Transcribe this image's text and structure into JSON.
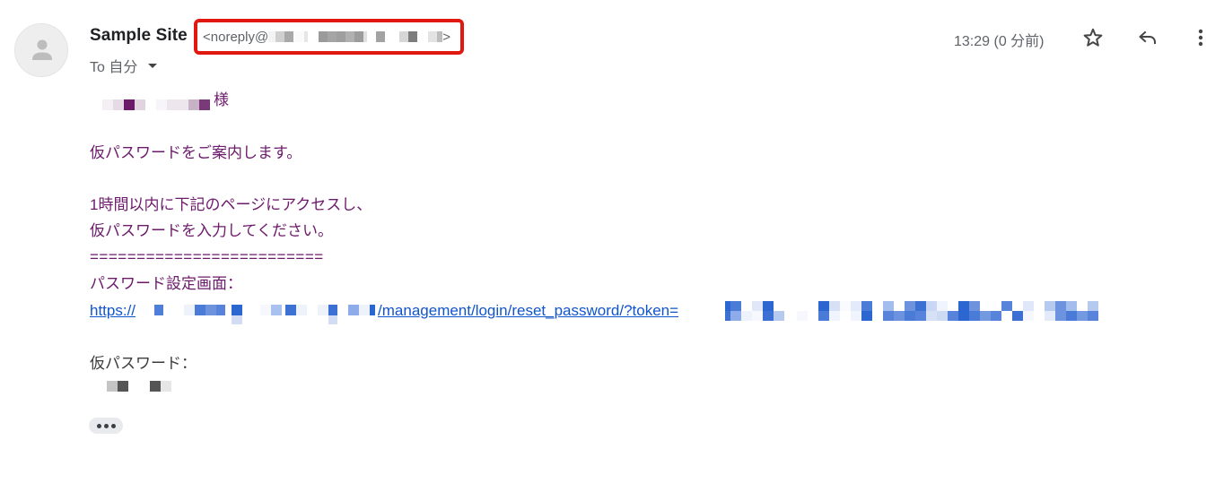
{
  "header": {
    "sender_name": "Sample Site",
    "sender_email_prefix": "<noreply@",
    "sender_email_suffix": ">",
    "recipient_label": "To 自分",
    "timestamp": "13:29 (0 分前)",
    "highlight_color": "#e0180f"
  },
  "icons": {
    "avatar": "person-icon",
    "star": "star-outline-icon",
    "reply": "reply-icon",
    "more": "more-vert-icon",
    "recipient_caret": "caret-down-icon"
  },
  "body": {
    "salutation_suffix": "様",
    "line1": "仮パスワードをご案内します。",
    "line2": "1時間以内に下記のページにアクセスし、",
    "line3": "仮パスワードを入力してください。",
    "separator": "=========================",
    "link_label": "パスワード設定画面：",
    "link_prefix": "https://",
    "link_path": "/management/login/reset_password/?token=",
    "temp_password_label": "仮パスワード："
  },
  "colors": {
    "body_text": "#6c1a6b",
    "link": "#1155cc",
    "secondary_text": "#5f6368"
  },
  "footer": {
    "show_trimmed_label": "•••"
  }
}
